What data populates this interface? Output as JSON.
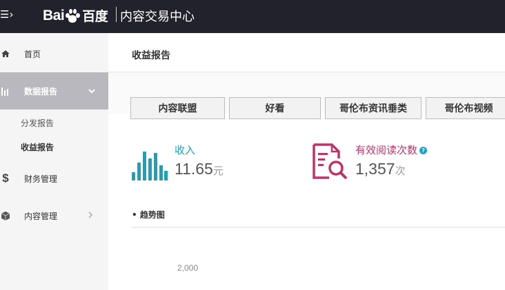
{
  "header": {
    "menu_glyph": "☰›",
    "logo_text_left": "Bai",
    "logo_text_right": "百度",
    "app_title": "内容交易中心"
  },
  "sidebar": {
    "items": [
      {
        "label": "首页",
        "icon": "home-icon"
      },
      {
        "label": "数据报告",
        "icon": "bar-chart-icon",
        "active": true
      },
      {
        "label": "财务管理",
        "icon": "dollar-icon"
      },
      {
        "label": "内容管理",
        "icon": "box-icon"
      }
    ],
    "sub_items": [
      {
        "label": "分发报告"
      },
      {
        "label": "收益报告",
        "selected": true
      }
    ]
  },
  "main": {
    "title": "收益报告",
    "tabs": [
      {
        "label": "内容联盟"
      },
      {
        "label": "好看"
      },
      {
        "label": "哥伦布资讯垂类"
      },
      {
        "label": "哥伦布视频"
      }
    ],
    "income": {
      "label": "收入",
      "value": "11.65",
      "unit": "元",
      "icon": "bar-chart-icon",
      "color": "#1aa3b8"
    },
    "reads": {
      "label": "有效阅读次数",
      "value": "1,357",
      "unit": "次",
      "icon": "document-search-icon",
      "color": "#c2306b",
      "help_icon": "help-icon"
    },
    "trend_title": "• 趋势图",
    "y_tick": "2,000"
  }
}
